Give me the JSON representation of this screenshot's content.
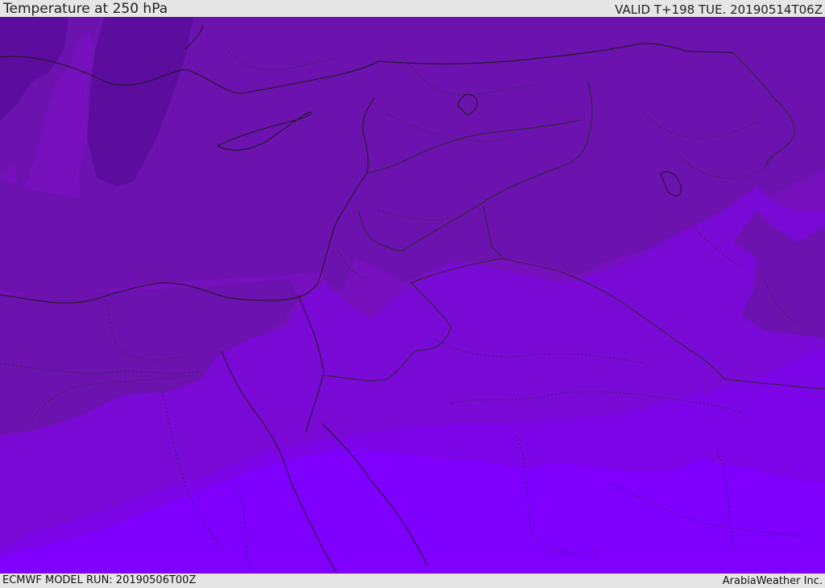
{
  "header": {
    "title": "Temperature at 250 hPa",
    "valid": "VALID T+198 TUE. 20190514T06Z"
  },
  "footer": {
    "model_run": "ECMWF MODEL RUN: 20190506T00Z",
    "credit": "ArabiaWeather Inc."
  },
  "colors": {
    "band_coldest": "#5d0d9e",
    "band_cold": "#6c12ae",
    "band_mid": "#7710bd",
    "band_warm": "#7a0ad6",
    "band_warmer": "#7c06e8",
    "band_warmest": "#7f00ff",
    "coastline": "#1a1a1a",
    "border": "#2a2a2a"
  }
}
